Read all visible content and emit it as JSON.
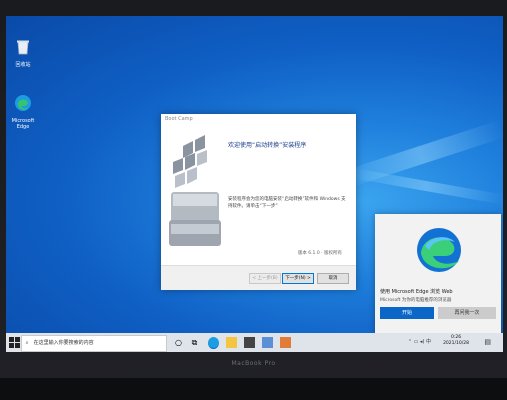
{
  "desktop": {
    "icons": [
      {
        "label": "回收站",
        "icon": "recycle-bin-icon"
      },
      {
        "label": "Microsoft Edge",
        "icon": "edge-icon"
      }
    ]
  },
  "setup": {
    "title": "Boot Camp",
    "heading": "欢迎使用“启动转换”安装程序",
    "body": "安装程序会为您的电脑安装“启动转换”软件和 Windows 支持软件。请单击“下一步”",
    "version": "版本 6.1.0 · 版权所有",
    "buttons": {
      "back": "< 上一步(B)",
      "next": "下一步(N) >",
      "cancel": "取消"
    }
  },
  "toast": {
    "title": "使用 Microsoft Edge 浏览 Web",
    "subtitle": "Microsoft 为你的电脑推荐的浏览器",
    "primary": "开始",
    "secondary": "再问我一次"
  },
  "taskbar": {
    "search_placeholder": "在这里输入你要搜索的内容",
    "time": "0:26",
    "date": "2021/10/28"
  },
  "laptop": {
    "brand": "MacBook Pro"
  },
  "colors": {
    "accent": "#0a67c8",
    "desktop": "#1f7fdc"
  }
}
